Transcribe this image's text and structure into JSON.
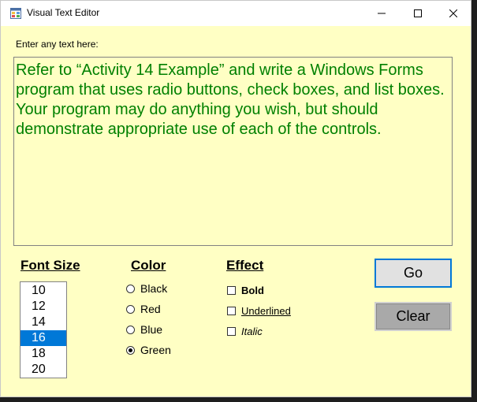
{
  "window": {
    "title": "Visual Text Editor"
  },
  "editor": {
    "prompt_label": "Enter any text here:",
    "text": "Refer to “Activity 14 Example” and write a Windows Forms program that uses radio buttons, check boxes, and list boxes. Your program may do anything you wish, but should demonstrate appropriate use of each of the controls.",
    "text_color": "#008000",
    "background": "#ffffc4"
  },
  "font_size": {
    "title": "Font Size",
    "options": [
      "10",
      "12",
      "14",
      "16",
      "18",
      "20"
    ],
    "selected": "16"
  },
  "color": {
    "title": "Color",
    "options": [
      "Black",
      "Red",
      "Blue",
      "Green"
    ],
    "selected": "Green"
  },
  "effect": {
    "title": "Effect",
    "options": [
      "Bold",
      "Underlined",
      "Italic"
    ],
    "checked": []
  },
  "buttons": {
    "go": "Go",
    "clear": "Clear"
  },
  "icons": {
    "app": "window-form-icon",
    "minimize": "minimize-icon",
    "maximize": "maximize-icon",
    "close": "close-icon"
  },
  "colors": {
    "accent": "#0078d7",
    "form_background": "#ffffc4"
  }
}
